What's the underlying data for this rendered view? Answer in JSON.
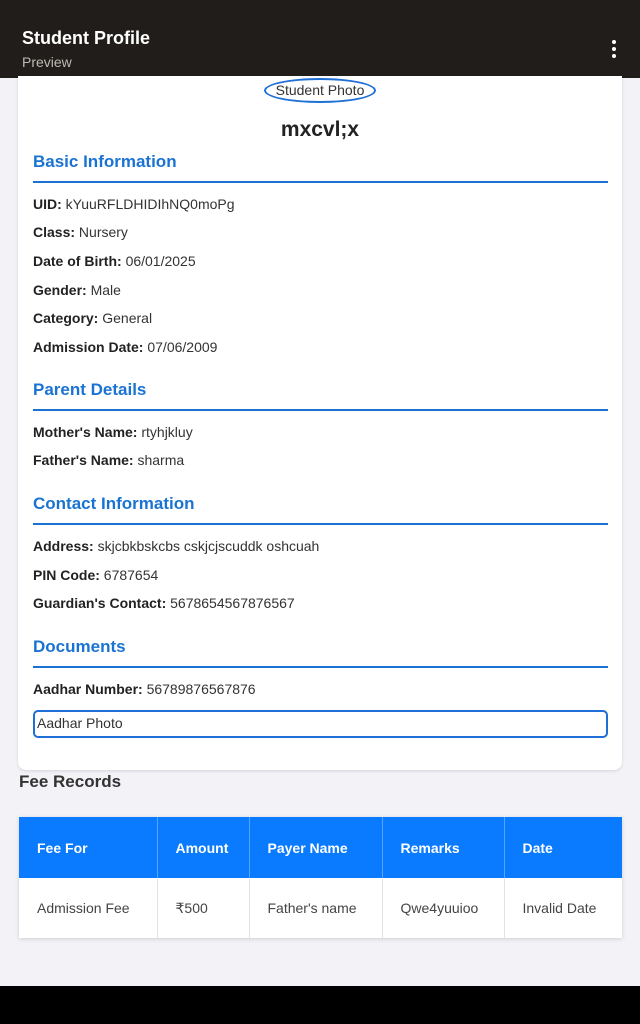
{
  "appbar": {
    "title": "Student Profile",
    "subtitle": "Preview",
    "menu_icon": "more-vert-icon"
  },
  "profile": {
    "photo_alt": "Student Photo",
    "name": "mxcvl;x"
  },
  "basic": {
    "heading": "Basic Information",
    "fields": [
      {
        "label": "UID:",
        "value": "kYuuRFLDHIDIhNQ0moPg"
      },
      {
        "label": "Class:",
        "value": "Nursery"
      },
      {
        "label": "Date of Birth:",
        "value": "06/01/2025"
      },
      {
        "label": "Gender:",
        "value": "Male"
      },
      {
        "label": "Category:",
        "value": "General"
      },
      {
        "label": "Admission Date:",
        "value": "07/06/2009"
      }
    ]
  },
  "parents": {
    "heading": "Parent Details",
    "fields": [
      {
        "label": "Mother's Name:",
        "value": "rtyhjkluy"
      },
      {
        "label": "Father's Name:",
        "value": "sharma"
      }
    ]
  },
  "contact": {
    "heading": "Contact Information",
    "fields": [
      {
        "label": "Address:",
        "value": "skjcbkbskcbs cskjcjscuddk oshcuah"
      },
      {
        "label": "PIN Code:",
        "value": "6787654"
      },
      {
        "label": "Guardian's Contact:",
        "value": "5678654567876567"
      }
    ]
  },
  "documents": {
    "heading": "Documents",
    "fields": [
      {
        "label": "Aadhar Number:",
        "value": "56789876567876"
      }
    ],
    "aadhar_photo_alt": "Aadhar Photo"
  },
  "fees": {
    "heading": "Fee Records",
    "columns": [
      "Fee For",
      "Amount",
      "Payer Name",
      "Remarks",
      "Date"
    ],
    "rows": [
      [
        "Admission Fee",
        "₹500",
        "Father's name",
        "Qwe4yuuioo",
        "Invalid Date"
      ]
    ]
  },
  "colors": {
    "accent": "#1a73d3",
    "table_header": "#0a7bff",
    "appbar": "#211d1a"
  }
}
